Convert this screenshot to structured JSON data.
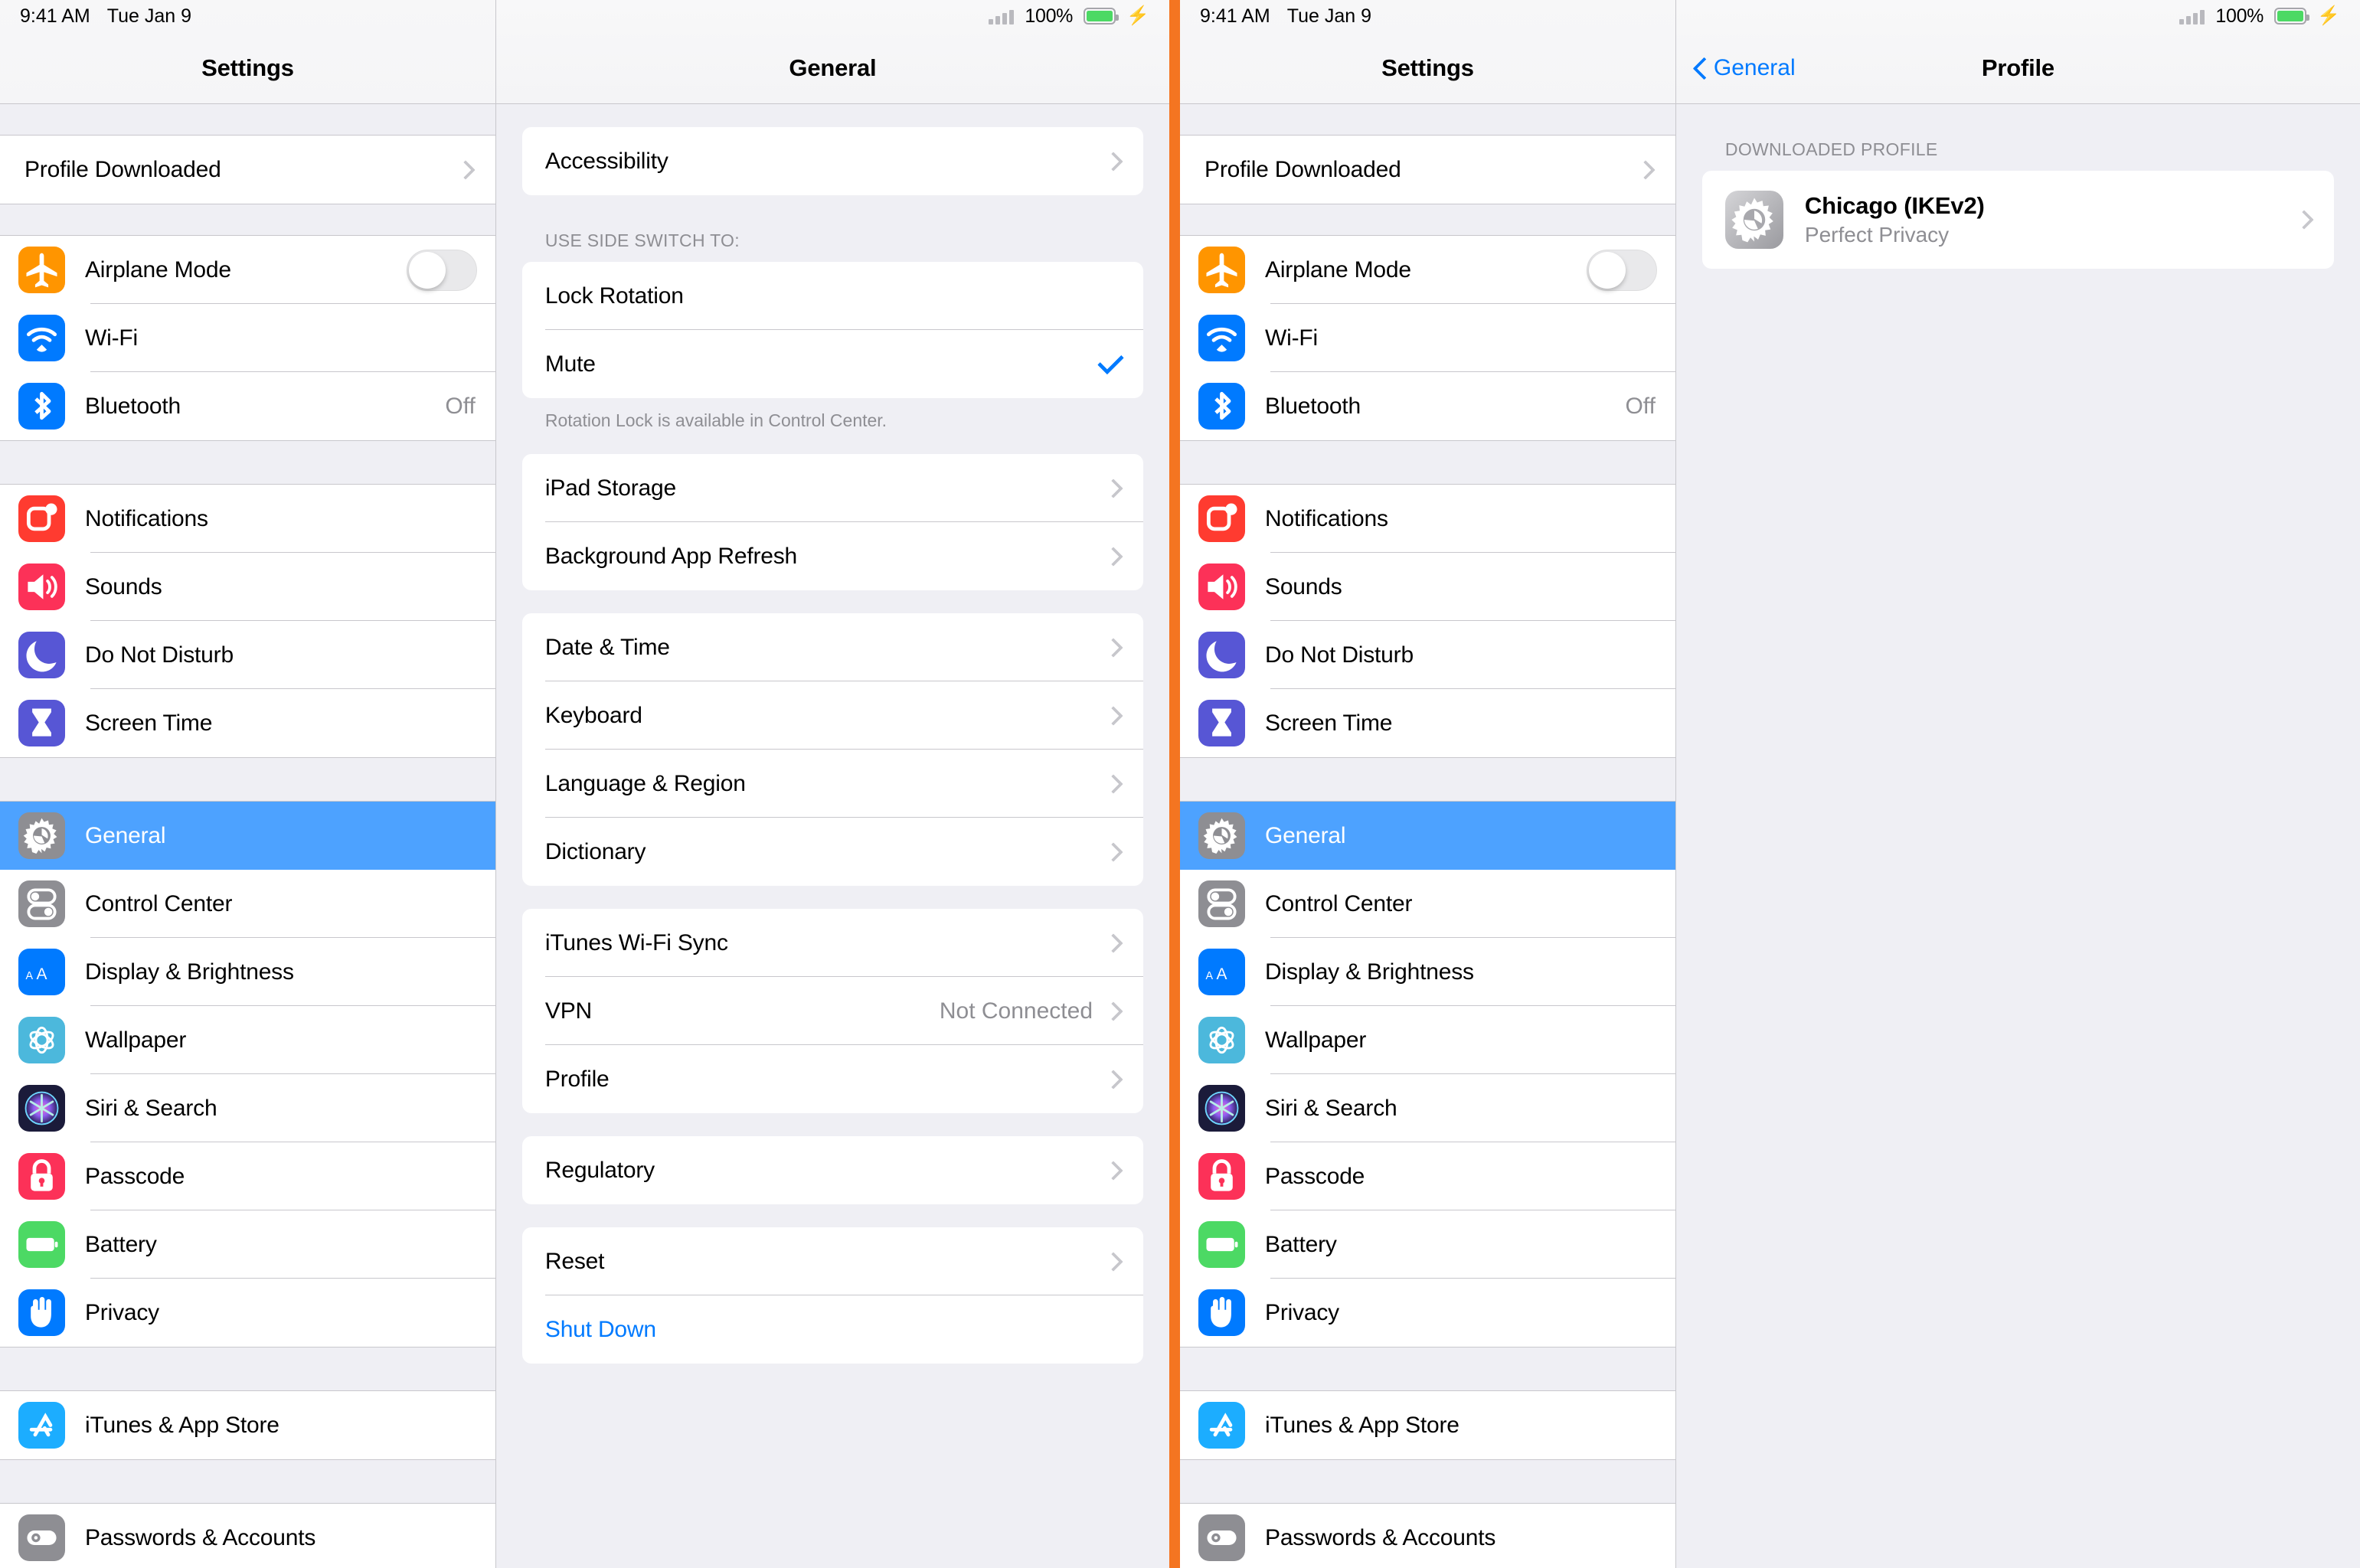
{
  "status_bar": {
    "time": "9:41 AM",
    "date": "Tue Jan 9",
    "battery_pct": "100%",
    "signal_icon": "signal-bars-icon",
    "battery_icon": "battery-full-icon",
    "charging_icon": "lightning-bolt-icon",
    "battery_color": "#4cd964"
  },
  "colors": {
    "accent_blue": "#007aff",
    "selection_blue": "#4da2ff",
    "divider_orange": "#f47521",
    "group_bg": "#efeff4",
    "secondary_text": "#8e8e93"
  },
  "sidebar": {
    "title": "Settings",
    "profile_banner": {
      "label": "Profile Downloaded"
    },
    "groups": [
      {
        "items": [
          {
            "label": "Airplane Mode",
            "icon": "airplane-icon",
            "icon_color": "#ff9500",
            "accessory": "toggle",
            "toggle_on": false
          },
          {
            "label": "Wi-Fi",
            "icon": "wifi-icon",
            "icon_color": "#007aff",
            "accessory": "none"
          },
          {
            "label": "Bluetooth",
            "icon": "bluetooth-icon",
            "icon_color": "#007aff",
            "accessory": "value",
            "value": "Off"
          }
        ]
      },
      {
        "items": [
          {
            "label": "Notifications",
            "icon": "notifications-icon",
            "icon_color": "#ff3b30",
            "accessory": "none"
          },
          {
            "label": "Sounds",
            "icon": "sounds-icon",
            "icon_color": "#fc3158",
            "accessory": "none"
          },
          {
            "label": "Do Not Disturb",
            "icon": "moon-icon",
            "icon_color": "#5756d5",
            "accessory": "none"
          },
          {
            "label": "Screen Time",
            "icon": "hourglass-icon",
            "icon_color": "#5756d5",
            "accessory": "none"
          }
        ]
      },
      {
        "items": [
          {
            "label": "General",
            "icon": "gear-icon",
            "icon_color": "#8e8e93",
            "accessory": "none",
            "selected": true
          },
          {
            "label": "Control Center",
            "icon": "control-center-icon",
            "icon_color": "#8e8e93",
            "accessory": "none"
          },
          {
            "label": "Display & Brightness",
            "icon": "display-brightness-icon",
            "icon_color": "#007aff",
            "accessory": "none"
          },
          {
            "label": "Wallpaper",
            "icon": "wallpaper-icon",
            "icon_color": "#4cb8dc",
            "accessory": "none"
          },
          {
            "label": "Siri & Search",
            "icon": "siri-icon",
            "icon_color": "#1b1b3a",
            "accessory": "none"
          },
          {
            "label": "Passcode",
            "icon": "passcode-lock-icon",
            "icon_color": "#fc3158",
            "accessory": "none"
          },
          {
            "label": "Battery",
            "icon": "battery-icon",
            "icon_color": "#4cd964",
            "accessory": "none"
          },
          {
            "label": "Privacy",
            "icon": "privacy-hand-icon",
            "icon_color": "#007aff",
            "accessory": "none"
          }
        ]
      },
      {
        "items": [
          {
            "label": "iTunes & App Store",
            "icon": "app-store-icon",
            "icon_color": "#1cadff",
            "accessory": "none"
          }
        ]
      },
      {
        "items": [
          {
            "label": "Passwords & Accounts",
            "icon": "passwords-accounts-icon",
            "icon_color": "#8e8e93",
            "accessory": "none"
          }
        ]
      }
    ]
  },
  "general_pane": {
    "title": "General",
    "groups": [
      {
        "header": "",
        "footer": "",
        "rows": [
          {
            "label": "Accessibility",
            "accessory": "chevron"
          }
        ]
      },
      {
        "header": "USE SIDE SWITCH TO:",
        "footer": "Rotation Lock is available in Control Center.",
        "rows": [
          {
            "label": "Lock Rotation",
            "accessory": "none"
          },
          {
            "label": "Mute",
            "accessory": "check"
          }
        ]
      },
      {
        "header": "",
        "footer": "",
        "rows": [
          {
            "label": "iPad Storage",
            "accessory": "chevron"
          },
          {
            "label": "Background App Refresh",
            "accessory": "chevron"
          }
        ]
      },
      {
        "header": "",
        "footer": "",
        "rows": [
          {
            "label": "Date & Time",
            "accessory": "chevron"
          },
          {
            "label": "Keyboard",
            "accessory": "chevron"
          },
          {
            "label": "Language & Region",
            "accessory": "chevron"
          },
          {
            "label": "Dictionary",
            "accessory": "chevron"
          }
        ]
      },
      {
        "header": "",
        "footer": "",
        "rows": [
          {
            "label": "iTunes Wi-Fi Sync",
            "accessory": "chevron"
          },
          {
            "label": "VPN",
            "accessory": "chevron",
            "value": "Not Connected"
          },
          {
            "label": "Profile",
            "accessory": "chevron"
          }
        ]
      },
      {
        "header": "",
        "footer": "",
        "rows": [
          {
            "label": "Regulatory",
            "accessory": "chevron"
          }
        ]
      },
      {
        "header": "",
        "footer": "",
        "rows": [
          {
            "label": "Reset",
            "accessory": "chevron"
          },
          {
            "label": "Shut Down",
            "accessory": "none",
            "style": "blue"
          }
        ]
      }
    ]
  },
  "profile_pane": {
    "title": "Profile",
    "back_label": "General",
    "group_header": "DOWNLOADED PROFILE",
    "profile": {
      "name": "Chicago (IKEv2)",
      "organization": "Perfect Privacy",
      "icon": "gear-icon"
    }
  }
}
